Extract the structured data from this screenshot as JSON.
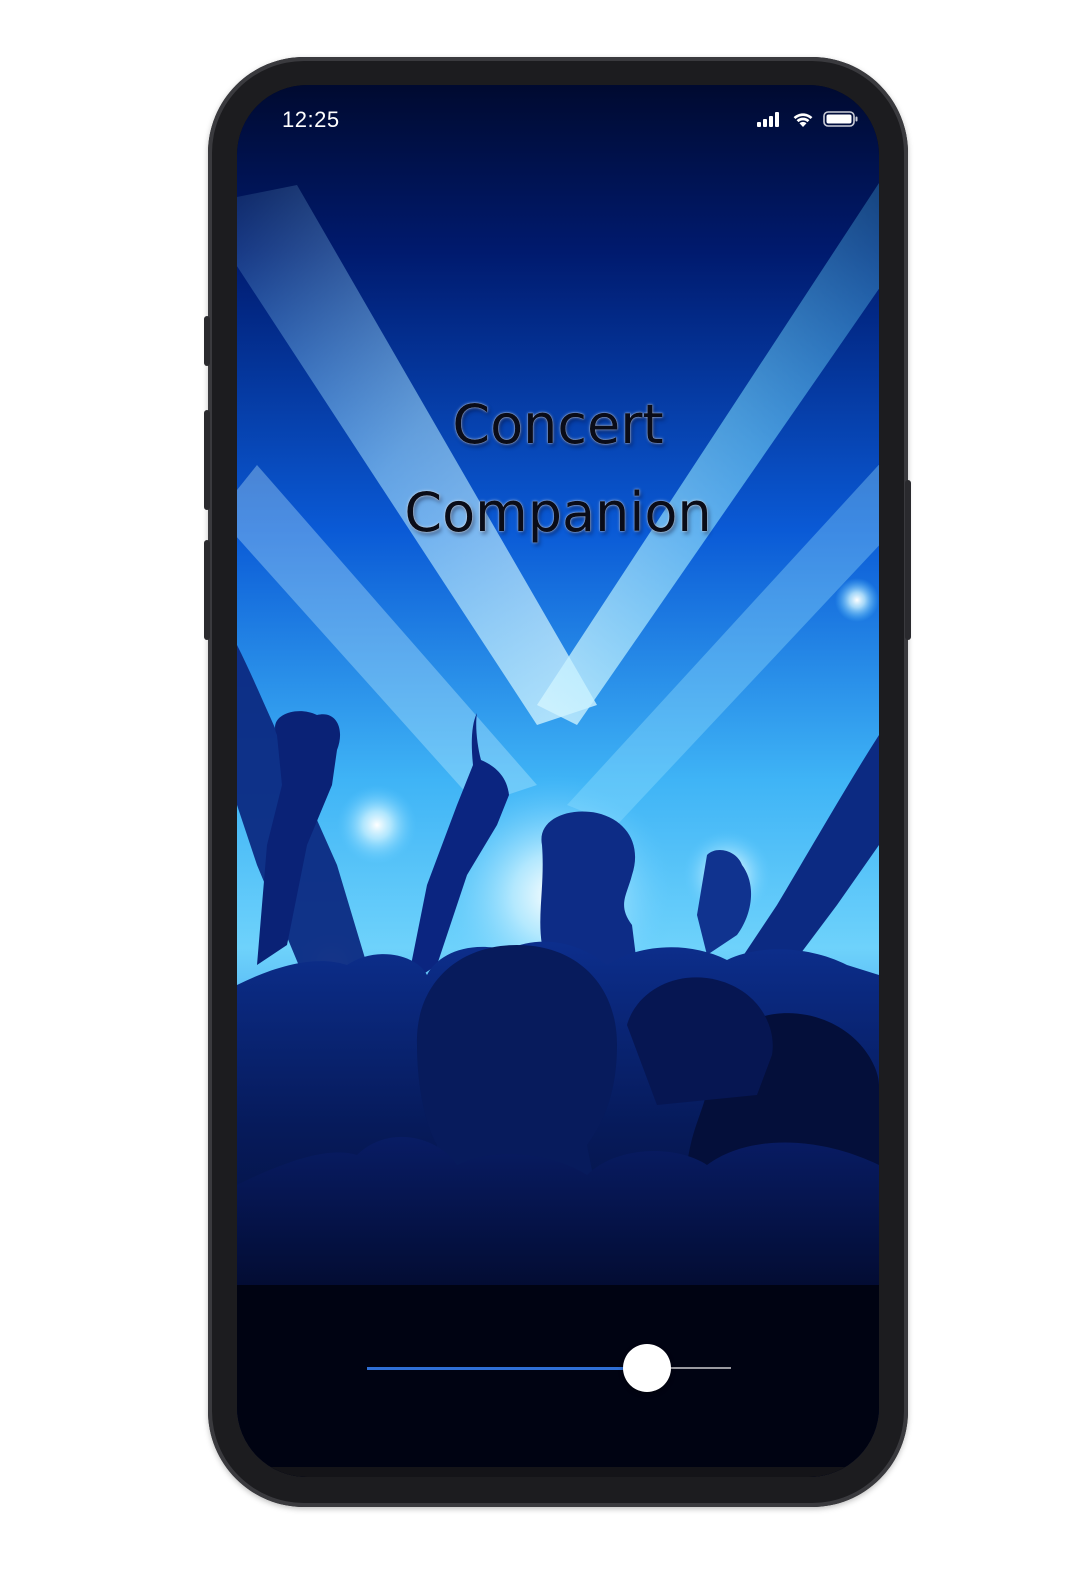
{
  "status_bar": {
    "time": "12:25",
    "icons": [
      "cellular-signal-icon",
      "wifi-icon",
      "battery-icon"
    ]
  },
  "splash": {
    "title_line1": "Concert",
    "title_line2": "Companion",
    "background": "concert-crowd-silhouette-image"
  },
  "progress_slider": {
    "value": 0.77,
    "fill_color": "#2f6fd6",
    "track_color": "#9a9aa0",
    "thumb_color": "#ffffff"
  },
  "colors": {
    "frame": "#1c1c1f",
    "sky_top": "#000d3a",
    "spot_light": "#4fd4ff",
    "crowd": "#000418"
  }
}
